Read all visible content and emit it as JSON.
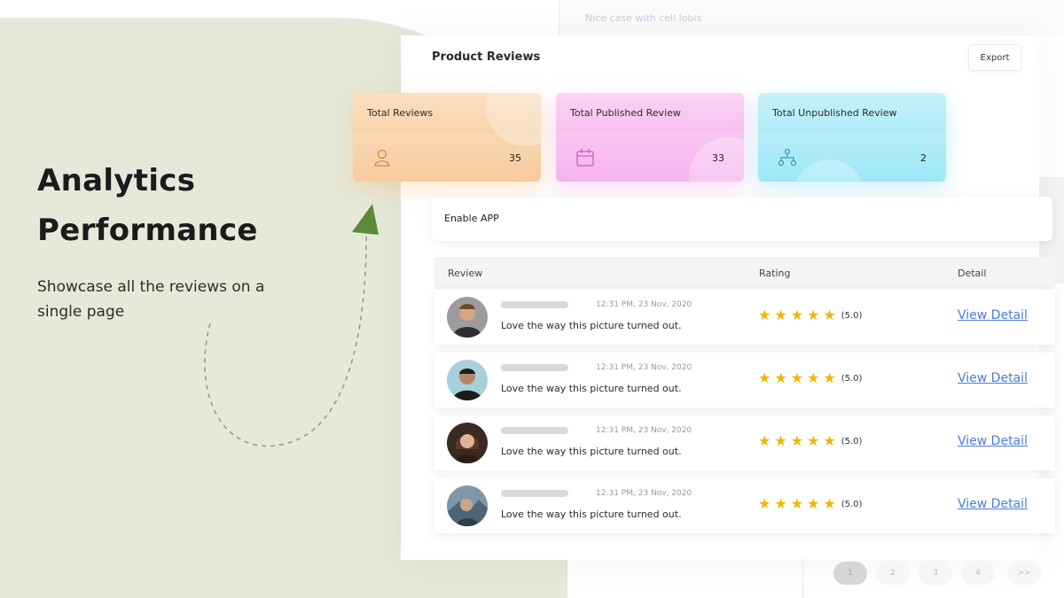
{
  "hero": {
    "title_line1": "Analytics",
    "title_line2": "Performance",
    "subtitle": "Showcase all the reviews on a single page"
  },
  "background": {
    "top_text": "Nice case with cell lobis"
  },
  "dashboard": {
    "title": "Product Reviews",
    "export_label": "Export",
    "stats": [
      {
        "label": "Total Reviews",
        "value": "35",
        "icon": "user-icon",
        "color": "#f7c48f"
      },
      {
        "label": "Total Published Review",
        "value": "33",
        "icon": "calendar-icon",
        "color": "#f5a8ec"
      },
      {
        "label": "Total Unpublished Review",
        "value": "2",
        "icon": "network-icon",
        "color": "#8fe4f7"
      }
    ],
    "enable_label": "Enable APP",
    "table": {
      "headers": {
        "review": "Review",
        "rating": "Rating",
        "detail": "Detail"
      },
      "rows": [
        {
          "timestamp": "12:31 PM, 23 Nov, 2020",
          "comment": "Love the way this picture turned out.",
          "rating": 5,
          "rating_text": "(5.0)",
          "link": "View Detail"
        },
        {
          "timestamp": "12:31 PM, 23 Nov, 2020",
          "comment": "Love the way this picture turned out.",
          "rating": 5,
          "rating_text": "(5.0)",
          "link": "View Detail"
        },
        {
          "timestamp": "12:31 PM, 23 Nov, 2020",
          "comment": "Love the way this picture turned out.",
          "rating": 5,
          "rating_text": "(5.0)",
          "link": "View Detail"
        },
        {
          "timestamp": "12:31 PM, 23 Nov, 2020",
          "comment": "Love the way this picture turned out.",
          "rating": 5,
          "rating_text": "(5.0)",
          "link": "View Detail"
        }
      ]
    },
    "pagination": [
      "1",
      "2",
      "3",
      "4",
      ">>"
    ]
  },
  "colors": {
    "accent_green": "#5c8a3a",
    "link_blue": "#4d7bd6",
    "star_gold": "#f4b400",
    "hero_bg": "#e5e9d9"
  }
}
